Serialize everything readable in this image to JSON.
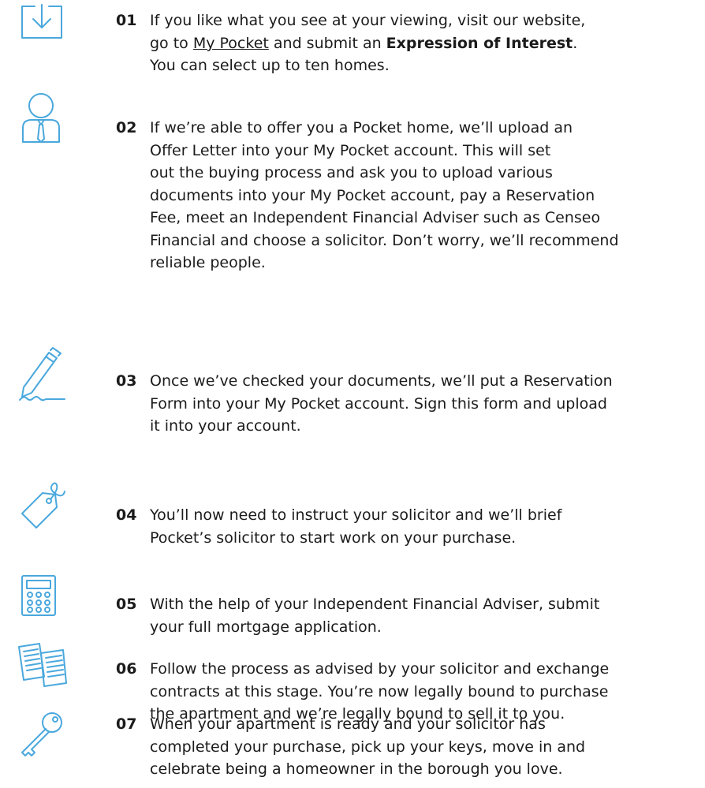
{
  "colors": {
    "icon": "#4aa8dd",
    "text": "#1b1b1b"
  },
  "steps": [
    {
      "icon": "download-box-icon",
      "number": "01",
      "p1": "If you like what you see at your viewing, visit our website,",
      "p2a": "go to ",
      "p2link": "My Pocket",
      "p2b": " and submit an ",
      "p2bold": "Expression of Interest",
      "p2c": ".",
      "p3": "You can select up to ten homes."
    },
    {
      "icon": "person-icon",
      "number": "02",
      "lines": [
        "If we’re able to offer you a Pocket home, we’ll upload an",
        "Offer Letter into your My Pocket account. This will set",
        "out the buying process and ask you to upload various",
        "documents into your My Pocket account, pay a Reservation",
        "Fee, meet an Independent Financial Adviser such as Censeo",
        "Financial and choose a solicitor. Don’t worry, we’ll recommend",
        "reliable people."
      ]
    },
    {
      "icon": "pen-signature-icon",
      "number": "03",
      "lines": [
        "Once we’ve checked your documents, we’ll put a Reservation",
        "Form into your My Pocket account. Sign this form and upload",
        "it into your account."
      ]
    },
    {
      "icon": "tag-icon",
      "number": "04",
      "lines": [
        "You’ll now need to instruct your solicitor and we’ll brief",
        "Pocket’s solicitor to start work on your purchase."
      ]
    },
    {
      "icon": "calculator-icon",
      "number": "05",
      "lines": [
        "With the help of your Independent Financial Adviser, submit",
        "your full mortgage application."
      ]
    },
    {
      "icon": "documents-icon",
      "number": "06",
      "lines": [
        "Follow the process as advised by your solicitor and exchange",
        "contracts at this stage. You’re now legally bound to purchase",
        "the apartment and we’re legally bound to sell it to you."
      ]
    },
    {
      "icon": "key-icon",
      "number": "07",
      "lines": [
        "When your apartment is ready and your solicitor has",
        "completed your purchase, pick up your keys, move in and",
        "celebrate being a homeowner in the borough you love."
      ]
    }
  ]
}
